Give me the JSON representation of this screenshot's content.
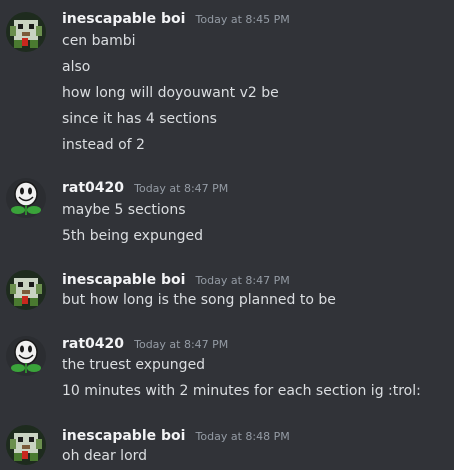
{
  "messages": [
    {
      "username": "inescapable boi",
      "timestamp": "Today at 8:45 PM",
      "avatar_icon": "pixel-creature-avatar-icon",
      "lines": [
        "cen bambi",
        "also",
        "how long will doyouwant v2 be",
        "since it has 4 sections",
        "instead of 2"
      ]
    },
    {
      "username": "rat0420",
      "timestamp": "Today at 8:47 PM",
      "avatar_icon": "smiley-flower-avatar-icon",
      "lines": [
        "maybe 5 sections",
        "5th being expunged"
      ]
    },
    {
      "username": "inescapable boi",
      "timestamp": "Today at 8:47 PM",
      "avatar_icon": "pixel-creature-avatar-icon",
      "lines": [
        "but how long is the song planned to be"
      ]
    },
    {
      "username": "rat0420",
      "timestamp": "Today at 8:47 PM",
      "avatar_icon": "smiley-flower-avatar-icon",
      "lines": [
        "the truest expunged",
        "10 minutes with 2 minutes for each section ig :trol:"
      ]
    },
    {
      "username": "inescapable boi",
      "timestamp": "Today at 8:48 PM",
      "avatar_icon": "pixel-creature-avatar-icon",
      "lines": [
        "oh dear lord"
      ]
    }
  ],
  "colors": {
    "background": "#313338",
    "username": "#f2f3f5",
    "timestamp": "#949ba4",
    "text": "#dbdee1"
  }
}
